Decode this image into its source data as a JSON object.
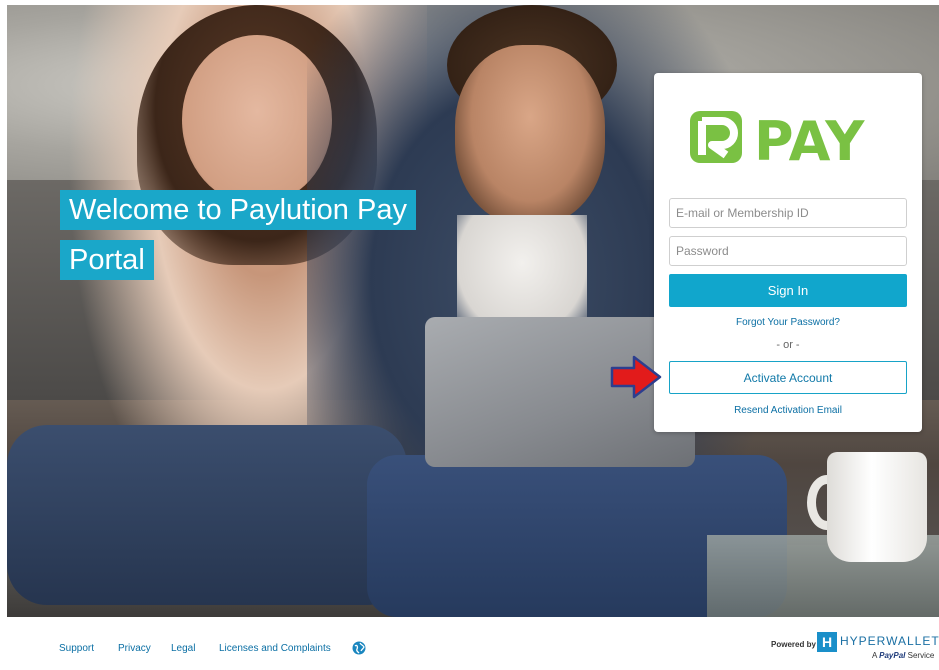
{
  "welcome": {
    "line1": "Welcome to Paylution Pay",
    "line2": "Portal"
  },
  "login": {
    "logo_text": "PAY",
    "email_placeholder": "E-mail or Membership ID",
    "password_placeholder": "Password",
    "signin_label": "Sign In",
    "forgot_label": "Forgot Your Password?",
    "or_label": "- or -",
    "activate_label": "Activate Account",
    "resend_label": "Resend Activation Email"
  },
  "footer": {
    "links": [
      "Support",
      "Privacy",
      "Legal",
      "Licenses and Complaints"
    ],
    "powered_by": "Powered by",
    "brand_mark": "H",
    "brand_name": "HYPERWALLET",
    "brand_sub_prefix": "A",
    "brand_sub_paypal": "PayPal",
    "brand_sub_suffix": "Service"
  },
  "colors": {
    "accent": "#1aa7c9",
    "logo_green": "#7ac143",
    "link": "#0b6fa4",
    "arrow_red": "#e21b1b",
    "arrow_outline": "#2d3e8f"
  },
  "icons": {
    "globe": "globe-icon",
    "arrow": "red-arrow-pointer"
  }
}
